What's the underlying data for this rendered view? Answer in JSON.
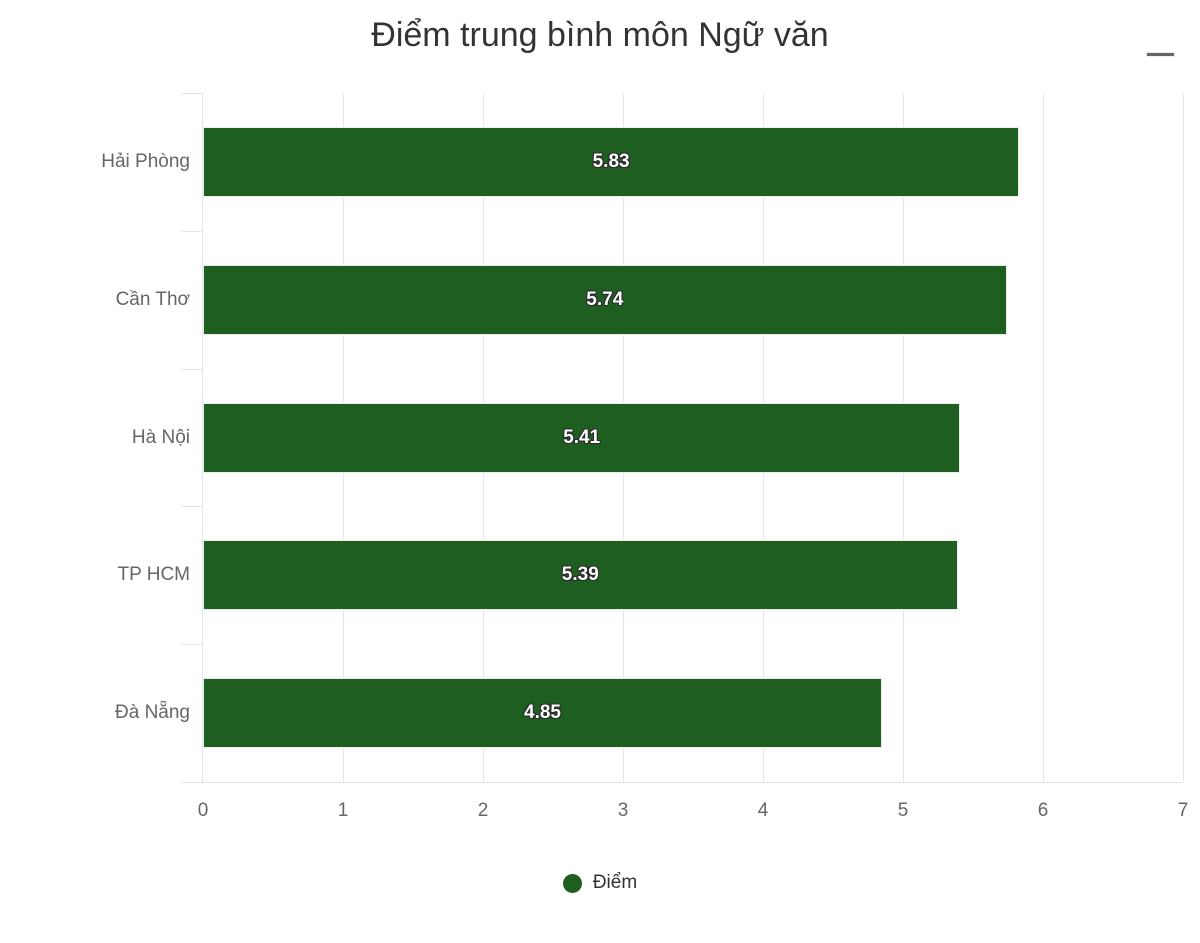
{
  "chart_data": {
    "type": "bar",
    "orientation": "horizontal",
    "title": "Điểm trung bình môn Ngữ văn",
    "xlabel": "",
    "ylabel": "",
    "categories": [
      "Hải Phòng",
      "Cần Thơ",
      "Hà Nội",
      "TP HCM",
      "Đà Nẵng"
    ],
    "values": [
      5.83,
      5.74,
      5.41,
      5.39,
      4.85
    ],
    "data_labels": [
      "5.83",
      "5.74",
      "5.41",
      "5.39",
      "4.85"
    ],
    "series": [
      {
        "name": "Điểm",
        "color": "#1e5e20",
        "values": [
          5.83,
          5.74,
          5.41,
          5.39,
          4.85
        ]
      }
    ],
    "xlim": [
      0,
      7
    ],
    "x_ticks": [
      "0",
      "1",
      "2",
      "3",
      "4",
      "5",
      "6",
      "7"
    ],
    "x_tick_values": [
      0,
      1,
      2,
      3,
      4,
      5,
      6,
      7
    ],
    "grid": true,
    "grid_orientation": "vertical",
    "legend": {
      "position": "bottom",
      "entries": [
        {
          "label": "Điểm",
          "color": "#1e5e20",
          "marker": "circle"
        }
      ]
    },
    "colors": {
      "bar": "#1e5e20",
      "title": "#333333",
      "axis_label": "#666666",
      "gridline": "#e6e6e6",
      "axis_line": "#dfe3ef",
      "data_label": "#ffffff",
      "background": "#ffffff"
    }
  },
  "toolbar": {
    "context_menu_label": "Chart context menu",
    "context_menu_icon": "hamburger-menu-icon"
  }
}
